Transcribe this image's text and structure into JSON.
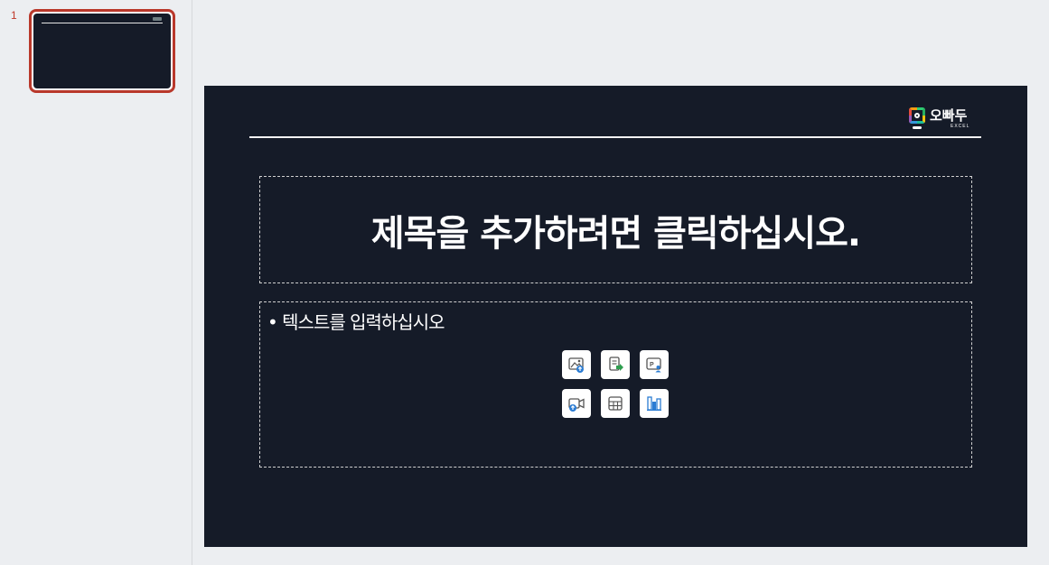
{
  "thumbnails": [
    {
      "number": "1",
      "selected": true
    }
  ],
  "slide": {
    "logo": {
      "text": "오빠두",
      "sub": "EXCEL"
    },
    "title_placeholder": "제목을 추가하려면 클릭하십시오.",
    "content_placeholder": "• 텍스트를 입력하십시오",
    "insert_buttons": [
      {
        "icon": "insert-picture-icon"
      },
      {
        "icon": "insert-stock-image-icon"
      },
      {
        "icon": "insert-cameo-icon"
      },
      {
        "icon": "insert-video-icon"
      },
      {
        "icon": "insert-table-icon"
      },
      {
        "icon": "insert-chart-icon"
      }
    ]
  },
  "colors": {
    "slide_background": "#151b28",
    "selection_border": "#b9382b",
    "accent_blue": "#2b7cd3",
    "accent_green": "#2e9e4f"
  }
}
